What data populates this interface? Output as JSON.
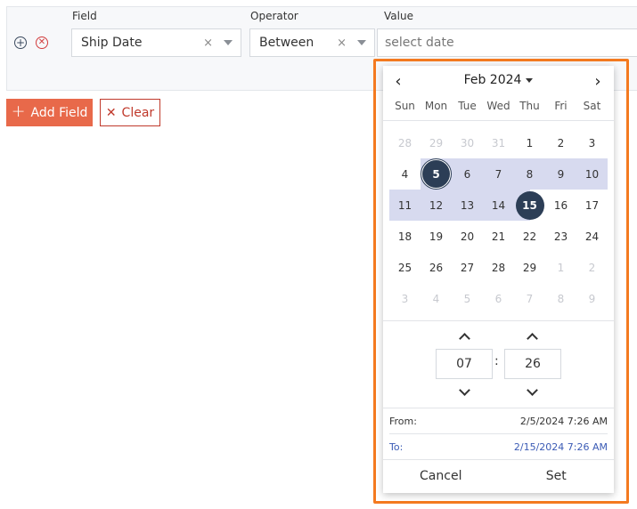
{
  "filter": {
    "field_label": "Field",
    "operator_label": "Operator",
    "value_label": "Value",
    "field_value": "Ship Date",
    "operator_value": "Between",
    "value_placeholder": "select date",
    "clear_glyph": "×"
  },
  "actions": {
    "add_field": "Add Field",
    "clear": "Clear"
  },
  "calendar": {
    "month_label": "Feb 2024",
    "weekdays": [
      "Sun",
      "Mon",
      "Tue",
      "Wed",
      "Thu",
      "Fri",
      "Sat"
    ],
    "weeks": [
      [
        "28",
        "29",
        "30",
        "31",
        "1",
        "2",
        "3"
      ],
      [
        "4",
        "5",
        "6",
        "7",
        "8",
        "9",
        "10"
      ],
      [
        "11",
        "12",
        "13",
        "14",
        "15",
        "16",
        "17"
      ],
      [
        "18",
        "19",
        "20",
        "21",
        "22",
        "23",
        "24"
      ],
      [
        "25",
        "26",
        "27",
        "28",
        "29",
        "1",
        "2"
      ],
      [
        "3",
        "4",
        "5",
        "6",
        "7",
        "8",
        "9"
      ]
    ],
    "hour": "07",
    "minute": "26",
    "colon": ":",
    "from_label": "From:",
    "from_value": "2/5/2024 7:26 AM",
    "to_label": "To:",
    "to_value": "2/15/2024 7:26 AM",
    "cancel": "Cancel",
    "set": "Set"
  },
  "colors": {
    "accent": "#e8694a",
    "danger": "#c0392b",
    "selected_day": "#2c3e56",
    "range_fill": "#d7daef",
    "highlight_outline": "#f47a20",
    "to_text": "#3b5bb5"
  }
}
